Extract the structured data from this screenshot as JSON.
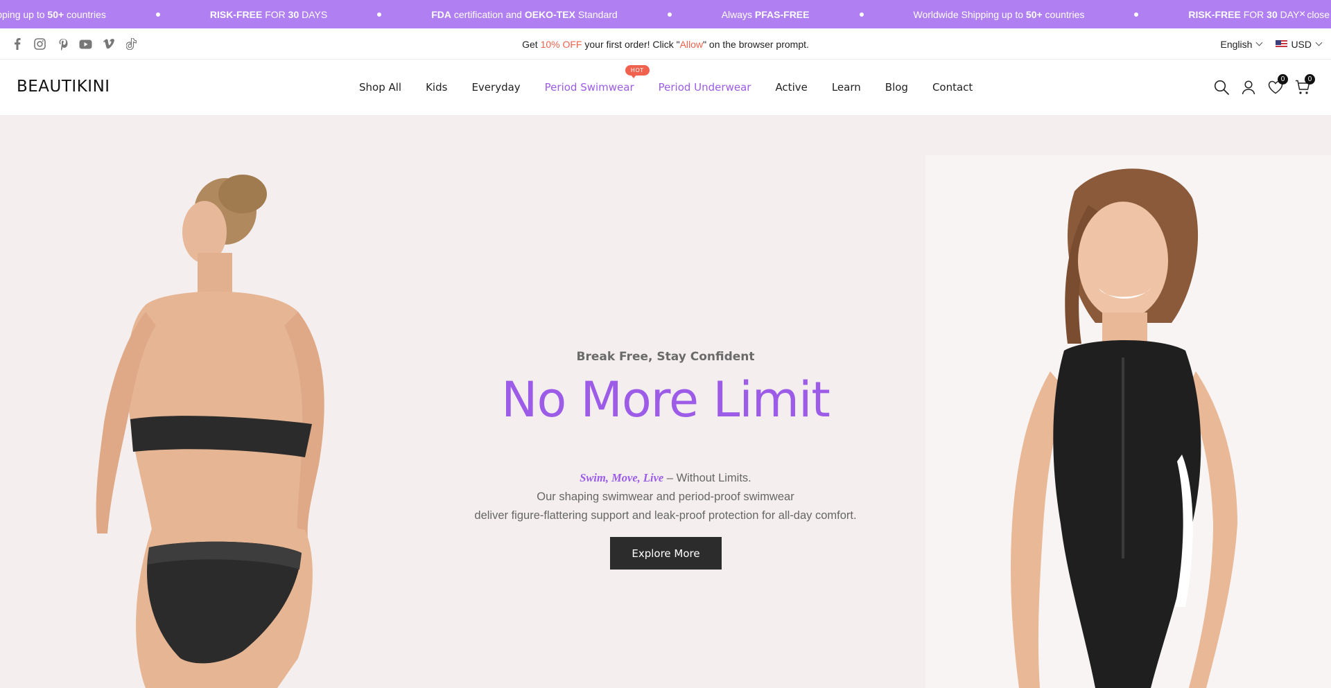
{
  "announcement": {
    "items": [
      {
        "pre": "Worldwide Shipping up to ",
        "bold": "50+",
        "post": " countries"
      },
      {
        "pre": "",
        "bold": "RISK-FREE",
        "mid": " FOR ",
        "bold2": "30",
        "post": " DAYS"
      },
      {
        "pre": "",
        "bold": "FDA",
        "mid": " certification and ",
        "bold2": "OEKO-TEX",
        "post": " Standard"
      },
      {
        "pre": "Always ",
        "bold": "PFAS-FREE",
        "post": ""
      }
    ],
    "close_label": "close"
  },
  "utility": {
    "socials": [
      "facebook-icon",
      "instagram-icon",
      "pinterest-icon",
      "youtube-icon",
      "vimeo-icon",
      "tiktok-icon"
    ],
    "promo": {
      "pre": "Get ",
      "highlight": "10% OFF",
      "mid": " your first order! Click \"",
      "highlight2": "Allow",
      "post": "\" on the browser prompt."
    },
    "language": "English",
    "currency": "USD"
  },
  "header": {
    "logo": "BEAUTIKINI",
    "nav": [
      {
        "label": "Shop All",
        "accent": false
      },
      {
        "label": "Kids",
        "accent": false
      },
      {
        "label": "Everyday",
        "accent": false
      },
      {
        "label": "Period Swimwear",
        "accent": true,
        "badge": "HOT"
      },
      {
        "label": "Period Underwear",
        "accent": true
      },
      {
        "label": "Active",
        "accent": false
      },
      {
        "label": "Learn",
        "accent": false
      },
      {
        "label": "Blog",
        "accent": false
      },
      {
        "label": "Contact",
        "accent": false
      }
    ],
    "wishlist_count": "0",
    "cart_count": "0"
  },
  "hero": {
    "eyebrow": "Break Free, Stay Confident",
    "headline": "No More Limit",
    "desc_em": "Swim, Move, Live",
    "desc_line1_rest": " – Without Limits.",
    "desc_line2": "Our shaping swimwear and period-proof swimwear",
    "desc_line3": "deliver figure-flattering support and leak-proof protection for all-day comfort.",
    "cta": "Explore More"
  },
  "colors": {
    "accent_purple": "#9c5ce8",
    "banner_purple": "#b07ff1",
    "promo_red": "#f0624d",
    "hero_bg": "#f4efee",
    "button_dark": "#2c2c2c"
  }
}
